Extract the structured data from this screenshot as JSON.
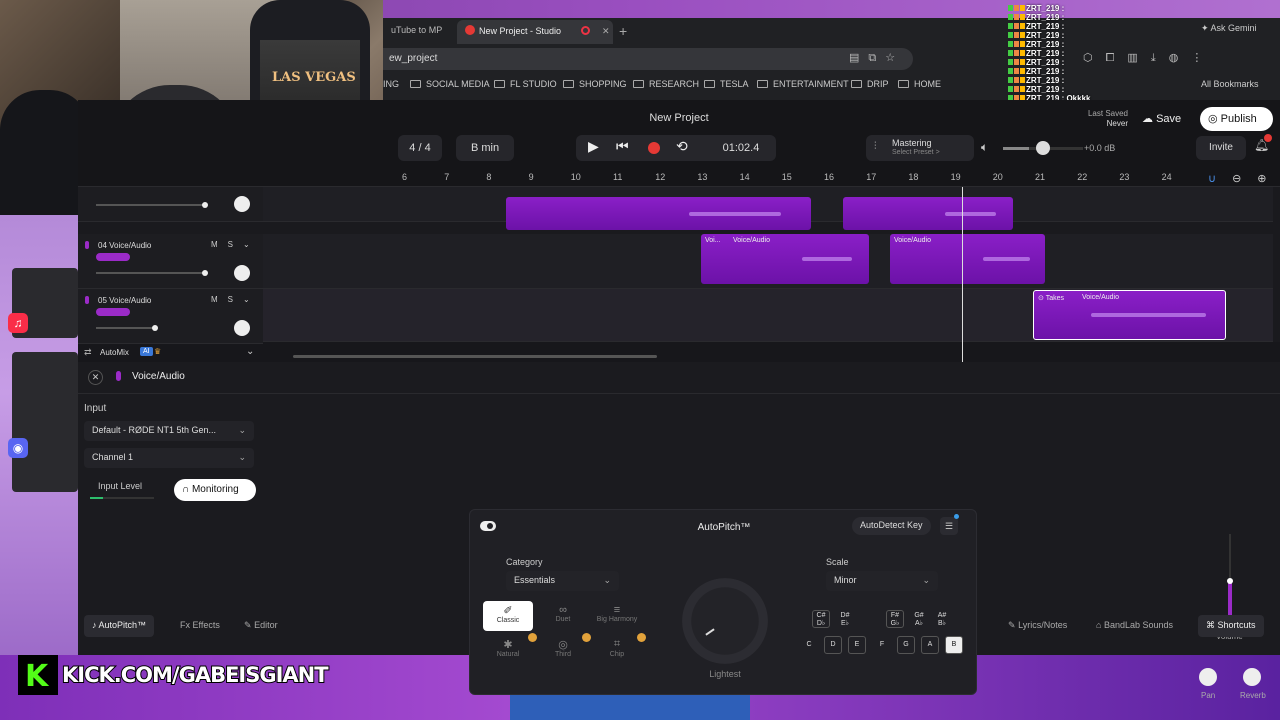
{
  "browser": {
    "tabs": [
      {
        "label": "uTube to MP"
      },
      {
        "label": "New Project - Studio",
        "active": true
      }
    ],
    "new_tab": "+",
    "ask_gemini": "Ask Gemini",
    "url": "ew_project",
    "bookmarks": [
      "ING",
      "SOCIAL MEDIA",
      "FL STUDIO",
      "SHOPPING",
      "RESEARCH",
      "TESLA",
      "ENTERTAINMENT",
      "DRIP",
      "HOME"
    ],
    "all_bookmarks": "All Bookmarks"
  },
  "chat": {
    "lines": [
      "ZRT_219 :",
      "ZRT_219 :",
      "ZRT_219 :",
      "ZRT_219 :",
      "ZRT_219 :",
      "ZRT_219 :",
      "ZRT_219 :",
      "ZRT_219 :",
      "ZRT_219 :",
      "ZRT_219 :",
      "ZRT_219 : Okkkk"
    ]
  },
  "webcam": {
    "shirt_text": "LAS VEGAS"
  },
  "daw": {
    "project_title": "New Project",
    "last_saved_label": "Last Saved",
    "last_saved_value": "Never",
    "save": "Save",
    "publish": "Publish",
    "time_sig": "4 / 4",
    "key": "B min",
    "time": "01:02.4",
    "mastering_title": "Mastering",
    "mastering_sub": "Select Preset >",
    "gain": "+0.0 dB",
    "master_volume_level": 0.33,
    "invite": "Invite",
    "ruler_ticks": [
      "6",
      "7",
      "8",
      "9",
      "10",
      "11",
      "12",
      "13",
      "14",
      "15",
      "16",
      "17",
      "18",
      "19",
      "20",
      "21",
      "22",
      "23",
      "24"
    ],
    "tracks": [
      {
        "name": "04 Voice/Audio",
        "m": "M",
        "s": "S"
      },
      {
        "name": "05 Voice/Audio",
        "m": "M",
        "s": "S"
      }
    ],
    "clips": {
      "voice_short": "Voi...",
      "voice": "Voice/Audio",
      "takes": "Takes"
    },
    "automix": "AutoMix",
    "ai_badge": "AI"
  },
  "editor": {
    "close": "✕",
    "track_title": "Voice/Audio",
    "input_label": "Input",
    "input_device": "Default - RØDE NT1 5th Gen...",
    "channel": "Channel 1",
    "input_level": "Input Level",
    "input_level_value": 0.2,
    "monitoring": "Monitoring",
    "autopitch": {
      "title": "AutoPitch™",
      "autodetect": "AutoDetect Key",
      "category_label": "Category",
      "category_value": "Essentials",
      "scale_label": "Scale",
      "scale_value": "Minor",
      "presets": [
        "Classic",
        "Duet",
        "Big Harmony",
        "Natural",
        "Third",
        "Chip"
      ],
      "strength": "Lightest",
      "keys_sharp": [
        {
          "top": "C#",
          "bottom": "D♭"
        },
        {
          "top": "D#",
          "bottom": "E♭"
        },
        {
          "top": "F#",
          "bottom": "G♭"
        },
        {
          "top": "G#",
          "bottom": "A♭"
        },
        {
          "top": "A#",
          "bottom": "B♭"
        }
      ],
      "keys_natural": [
        "C",
        "D",
        "E",
        "F",
        "G",
        "A",
        "B"
      ],
      "selected_key": "B"
    },
    "volume_label": "Volume",
    "volume_level": 0.5,
    "pan_label": "Pan",
    "reverb_label": "Reverb",
    "footer": {
      "autopitch": "AutoPitch™",
      "effects": "Effects",
      "editor": "Editor",
      "lyrics": "Lyrics/Notes",
      "bandlab": "BandLab Sounds",
      "shortcuts": "Shortcuts"
    }
  },
  "kick": {
    "letter": "K",
    "url": "KICK.COM/GABEISGIANT"
  }
}
